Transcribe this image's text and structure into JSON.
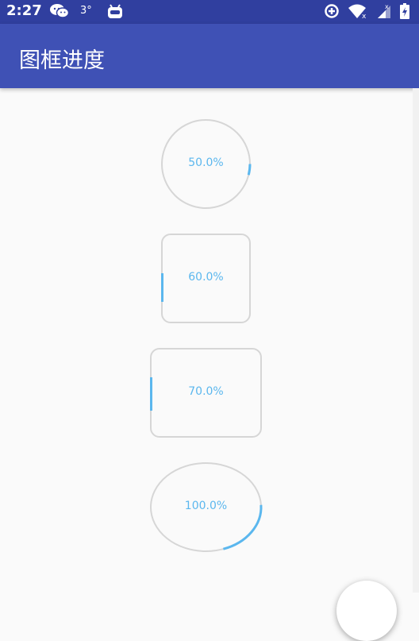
{
  "status_bar": {
    "time": "2:27",
    "temperature": "3°",
    "icons": [
      "wechat-icon",
      "android-icon",
      "sync-icon",
      "wifi-icon",
      "signal-icon",
      "battery-icon"
    ]
  },
  "toolbar": {
    "title": "图框进度"
  },
  "progress_items": [
    {
      "shape": "circle",
      "progress": 0.5,
      "label": "50.0%"
    },
    {
      "shape": "rounded-square",
      "progress": 0.6,
      "label": "60.0%"
    },
    {
      "shape": "rounded-rectangle",
      "progress": 0.7,
      "label": "70.0%"
    },
    {
      "shape": "ellipse",
      "progress": 1.0,
      "label": "100.0%"
    }
  ],
  "colors": {
    "status_bar": "#303f9f",
    "toolbar": "#3f51b5",
    "track": "#d6d6d6",
    "progress": "#5bb7ee",
    "background": "#fafafa"
  }
}
